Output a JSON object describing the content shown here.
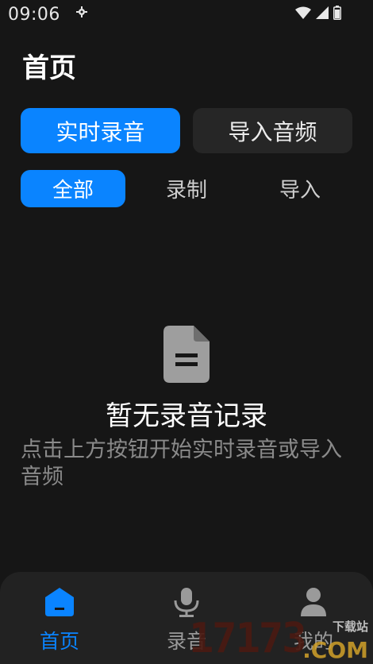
{
  "status_bar": {
    "time": "09:06"
  },
  "header": {
    "title": "首页"
  },
  "mode_tabs": {
    "realtime_label": "实时录音",
    "import_label": "导入音频"
  },
  "filters": {
    "all_label": "全部",
    "recorded_label": "录制",
    "imported_label": "导入"
  },
  "empty_state": {
    "icon": "document-icon",
    "title": "暂无录音记录",
    "description": "点击上方按钮开始实时录音或导入音频"
  },
  "bottom_nav": [
    {
      "label": "首页",
      "icon": "home-icon",
      "active": true
    },
    {
      "label": "录音",
      "icon": "microphone-icon",
      "active": false
    },
    {
      "label": "我的",
      "icon": "user-icon",
      "active": false
    }
  ],
  "watermark": {
    "number": "17173",
    "site": "下载站",
    "domain": ".COM"
  },
  "colors": {
    "accent": "#0a84ff",
    "background": "#161616",
    "surface": "#262626",
    "muted_text": "#8a8a8a"
  }
}
